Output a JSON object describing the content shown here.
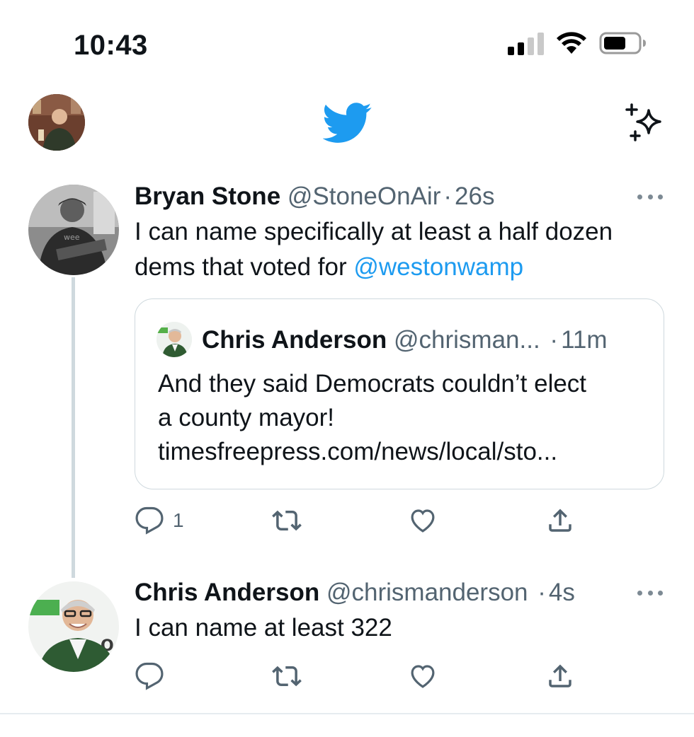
{
  "status_bar": {
    "time": "10:43"
  },
  "nav": {
    "logo_icon": "twitter-bird-icon",
    "sparkle_icon": "sparkle-icon",
    "accent_color": "#1d9bf0"
  },
  "tweets": [
    {
      "name": "Bryan Stone",
      "handle": "@StoneOnAir",
      "time": "26s",
      "text_before_mention": "I can name specifically at least a half dozen dems that voted for ",
      "mention": "@westonwamp",
      "quote": {
        "name": "Chris Anderson",
        "handle": "@chrisman...",
        "time": "11m",
        "text_line1": "And they said Democrats couldn’t elect",
        "text_line2": "a county mayor!",
        "text_line3": "timesfreepress.com/news/local/sto..."
      },
      "actions": {
        "reply_count": "1",
        "retweet_count": "",
        "like_count": ""
      }
    },
    {
      "name": "Chris Anderson",
      "handle": "@chrismanderson",
      "time": "4s",
      "text": "I can name at least 322",
      "actions": {
        "reply_count": "",
        "retweet_count": "",
        "like_count": ""
      }
    }
  ],
  "separator": "·"
}
